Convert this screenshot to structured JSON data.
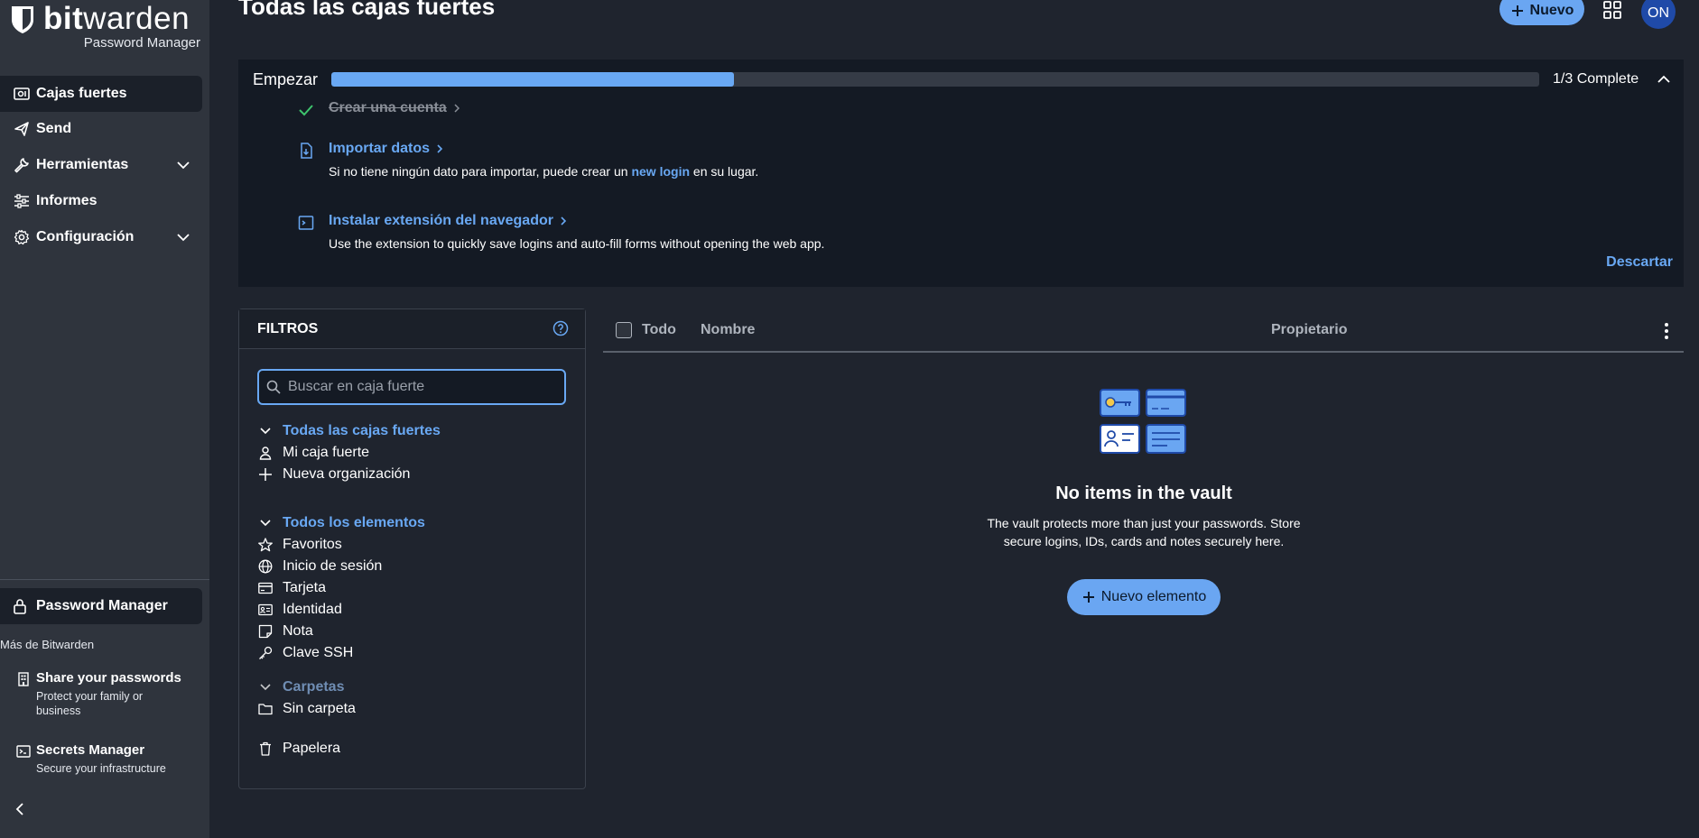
{
  "sidebar": {
    "logo_bold": "bit",
    "logo_rest": "warden",
    "logo_sub": "Password Manager",
    "items": [
      {
        "label": "Cajas fuertes",
        "icon": "vault-icon"
      },
      {
        "label": "Send",
        "icon": "send-icon"
      },
      {
        "label": "Herramientas",
        "icon": "wrench-icon"
      },
      {
        "label": "Informes",
        "icon": "sliders-icon"
      },
      {
        "label": "Configuración",
        "icon": "gear-icon"
      }
    ],
    "product": "Password Manager",
    "more_label": "Más de Bitwarden",
    "promos": [
      {
        "title": "Share your passwords",
        "desc": "Protect your family or business",
        "icon": "building-icon"
      },
      {
        "title": "Secrets Manager",
        "desc": "Secure your infrastructure",
        "icon": "terminal-icon"
      }
    ]
  },
  "header": {
    "title": "Todas las cajas fuertes",
    "new_label": "Nuevo",
    "avatar": "ON"
  },
  "onboarding": {
    "title": "Empezar",
    "progress": 0.333,
    "count": "1/3 Complete",
    "tasks": [
      {
        "title": "Crear una cuenta",
        "done": true
      },
      {
        "title": "Importar datos",
        "desc_pre": "Si no tiene ningún dato para importar, puede crear un ",
        "desc_link": "new login",
        "desc_post": " en su lugar."
      },
      {
        "title": "Instalar extensión del navegador",
        "desc": "Use the extension to quickly save logins and auto-fill forms without opening the web app."
      }
    ],
    "dismiss": "Descartar"
  },
  "filters": {
    "title": "FILTROS",
    "search_placeholder": "Buscar en caja fuerte",
    "vaults_head": "Todas las cajas fuertes",
    "my_vault": "Mi caja fuerte",
    "new_org": "Nueva organización",
    "items_head": "Todos los elementos",
    "types": [
      "Favoritos",
      "Inicio de sesión",
      "Tarjeta",
      "Identidad",
      "Nota",
      "Clave SSH"
    ],
    "folders_head": "Carpetas",
    "no_folder": "Sin carpeta",
    "trash": "Papelera"
  },
  "table": {
    "all": "Todo",
    "name": "Nombre",
    "owner": "Propietario"
  },
  "empty": {
    "title": "No items in the vault",
    "desc": "The vault protects more than just your passwords. Store secure logins, IDs, cards and notes securely here.",
    "button": "Nuevo elemento"
  }
}
